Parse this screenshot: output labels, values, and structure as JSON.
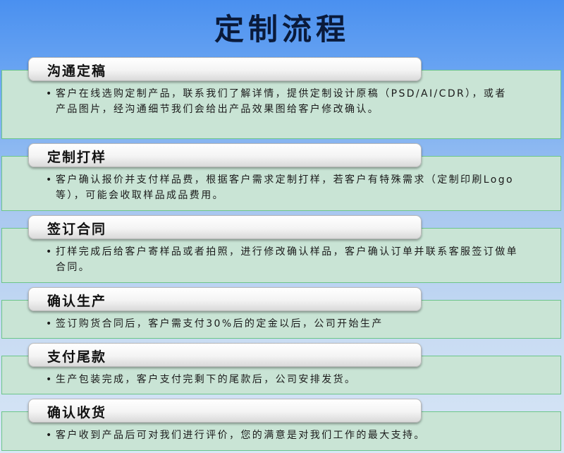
{
  "title": "定制流程",
  "steps": [
    {
      "label": "沟通定稿",
      "description": "客户在线选购定制产品，联系我们了解详情，提供定制设计原稿（PSD/AI/CDR），或者产品图片，经沟通细节我们会给出产品效果图给客户修改确认。"
    },
    {
      "label": "定制打样",
      "description": "客户确认报价并支付样品费，根据客户需求定制打样，若客户有特殊需求（定制印刷Logo等），可能会收取样品成品费用。"
    },
    {
      "label": "签订合同",
      "description": "打样完成后给客户寄样品或者拍照，进行修改确认样品，客户确认订单并联系客服签订做单合同。"
    },
    {
      "label": "确认生产",
      "description": "签订购货合同后，客户需支付30%后的定金以后，公司开始生产"
    },
    {
      "label": "支付尾款",
      "description": "生产包装完成，客户支付完剩下的尾款后，公司安排发货。"
    },
    {
      "label": "确认收货",
      "description": "客户收到产品后可对我们进行评价，您的满意是对我们工作的最大支持。"
    }
  ],
  "colors": {
    "panel_fill": "#c9e4d5",
    "panel_border": "#6cc58a",
    "background_top": "#4a90f0",
    "background_bottom": "#d8e6f6"
  }
}
